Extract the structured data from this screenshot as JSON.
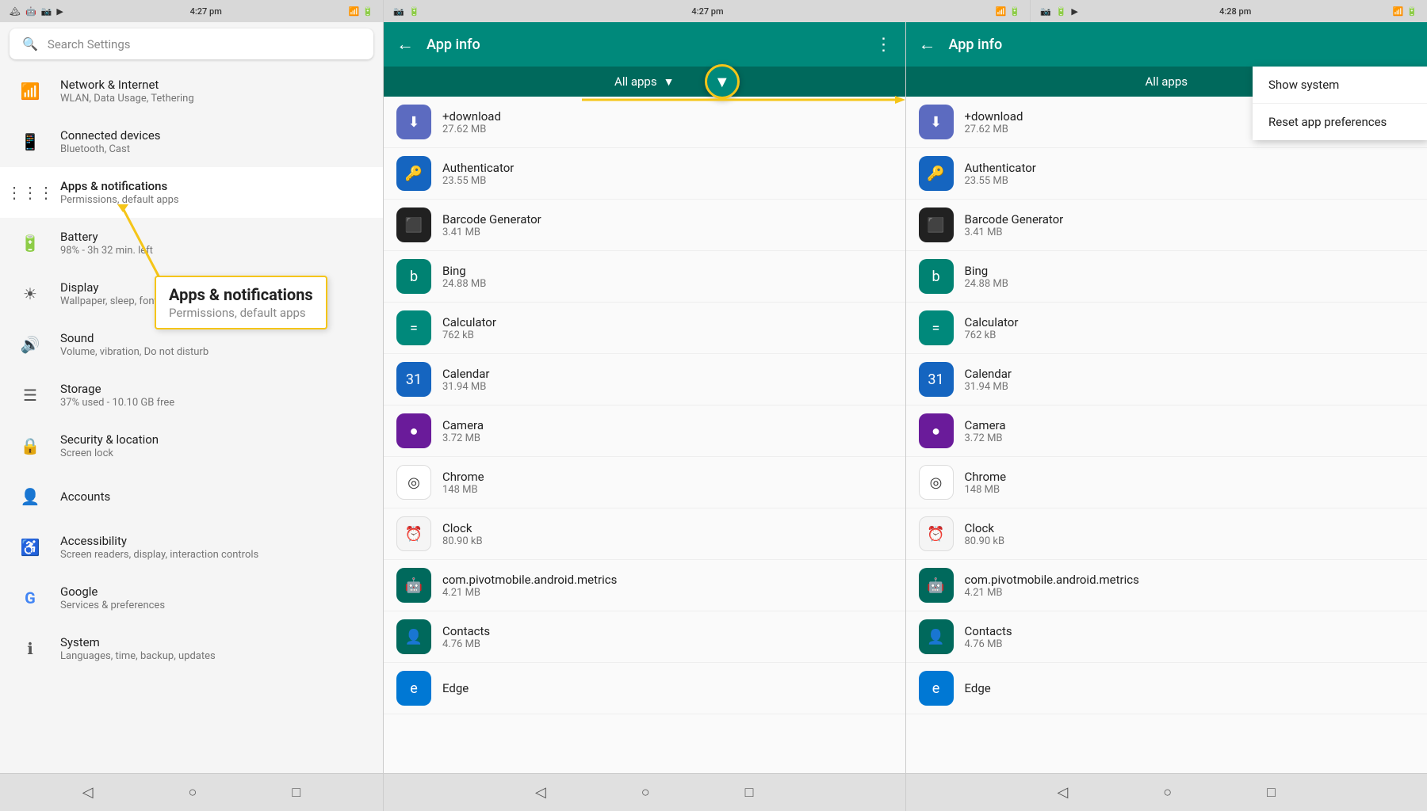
{
  "statusBar": {
    "left": {
      "time": "4:27 pm"
    },
    "middle": {
      "time": "4:27 pm"
    },
    "right": {
      "time": "4:28 pm"
    }
  },
  "settings": {
    "searchPlaceholder": "Search Settings",
    "items": [
      {
        "id": "network",
        "icon": "wifi",
        "title": "Network & Internet",
        "subtitle": "WLAN, Data Usage, Tethering"
      },
      {
        "id": "devices",
        "icon": "devices",
        "title": "Connected devices",
        "subtitle": "Bluetooth, Cast"
      },
      {
        "id": "apps",
        "icon": "apps",
        "title": "Apps & notifications",
        "subtitle": "Permissions, default apps",
        "highlighted": true
      },
      {
        "id": "battery",
        "icon": "battery",
        "title": "Battery",
        "subtitle": "98% - 3h 32 min. left"
      },
      {
        "id": "display",
        "icon": "display",
        "title": "Display",
        "subtitle": "Wallpaper, sleep, font size"
      },
      {
        "id": "sound",
        "icon": "sound",
        "title": "Sound",
        "subtitle": "Volume, vibration, Do not disturb"
      },
      {
        "id": "storage",
        "icon": "storage",
        "title": "Storage",
        "subtitle": "37% used - 10.10 GB free"
      },
      {
        "id": "security",
        "icon": "security",
        "title": "Security & location",
        "subtitle": "Screen lock"
      },
      {
        "id": "accounts",
        "icon": "accounts",
        "title": "Accounts",
        "subtitle": ""
      },
      {
        "id": "accessibility",
        "icon": "accessibility",
        "title": "Accessibility",
        "subtitle": "Screen readers, display, interaction controls"
      },
      {
        "id": "google",
        "icon": "google",
        "title": "Google",
        "subtitle": "Services & preferences"
      },
      {
        "id": "system",
        "icon": "system",
        "title": "System",
        "subtitle": "Languages, time, backup, updates"
      }
    ]
  },
  "tooltip": {
    "title": "Apps & notifications",
    "subtitle": "Permissions, default apps"
  },
  "appInfo": {
    "left": {
      "headerTitle": "App info",
      "allAppsLabel": "All apps",
      "apps": [
        {
          "name": "+download",
          "size": "27.62 MB",
          "icon": "⬇",
          "iconClass": "icon-download"
        },
        {
          "name": "Authenticator",
          "size": "23.55 MB",
          "icon": "🔑",
          "iconClass": "icon-authenticator"
        },
        {
          "name": "Barcode Generator",
          "size": "3.41 MB",
          "icon": "▦",
          "iconClass": "icon-barcode"
        },
        {
          "name": "Bing",
          "size": "24.88 MB",
          "icon": "b",
          "iconClass": "icon-bing"
        },
        {
          "name": "Calculator",
          "size": "762 kB",
          "icon": "=",
          "iconClass": "icon-calculator"
        },
        {
          "name": "Calendar",
          "size": "31.94 MB",
          "icon": "31",
          "iconClass": "icon-calendar"
        },
        {
          "name": "Camera",
          "size": "3.72 MB",
          "icon": "📷",
          "iconClass": "icon-camera"
        },
        {
          "name": "Chrome",
          "size": "148 MB",
          "icon": "🌐",
          "iconClass": "icon-chrome"
        },
        {
          "name": "Clock",
          "size": "80.90 kB",
          "icon": "🕐",
          "iconClass": "icon-clock"
        },
        {
          "name": "com.pivotmobile.android.metrics",
          "size": "4.21 MB",
          "icon": "🤖",
          "iconClass": "icon-metrics"
        },
        {
          "name": "Contacts",
          "size": "4.76 MB",
          "icon": "👤",
          "iconClass": "icon-contacts"
        },
        {
          "name": "Edge",
          "size": "",
          "icon": "e",
          "iconClass": "icon-edge"
        }
      ]
    },
    "right": {
      "headerTitle": "App info",
      "allAppsLabel": "All apps",
      "apps": [
        {
          "name": "+download",
          "size": "27.62 MB",
          "icon": "⬇",
          "iconClass": "icon-download"
        },
        {
          "name": "Authenticator",
          "size": "23.55 MB",
          "icon": "🔑",
          "iconClass": "icon-authenticator"
        },
        {
          "name": "Barcode Generator",
          "size": "3.41 MB",
          "icon": "▦",
          "iconClass": "icon-barcode"
        },
        {
          "name": "Bing",
          "size": "24.88 MB",
          "icon": "b",
          "iconClass": "icon-bing"
        },
        {
          "name": "Calculator",
          "size": "762 kB",
          "icon": "=",
          "iconClass": "icon-calculator"
        },
        {
          "name": "Calendar",
          "size": "31.94 MB",
          "icon": "31",
          "iconClass": "icon-calendar"
        },
        {
          "name": "Camera",
          "size": "3.72 MB",
          "icon": "📷",
          "iconClass": "icon-camera"
        },
        {
          "name": "Chrome",
          "size": "148 MB",
          "icon": "🌐",
          "iconClass": "icon-chrome"
        },
        {
          "name": "Clock",
          "size": "80.90 kB",
          "icon": "🕐",
          "iconClass": "icon-clock"
        },
        {
          "name": "com.pivotmobile.android.metrics",
          "size": "4.21 MB",
          "icon": "🤖",
          "iconClass": "icon-metrics"
        },
        {
          "name": "Contacts",
          "size": "4.76 MB",
          "icon": "👤",
          "iconClass": "icon-contacts"
        },
        {
          "name": "Edge",
          "size": "",
          "icon": "e",
          "iconClass": "icon-edge"
        }
      ]
    }
  },
  "contextMenu": {
    "items": [
      {
        "id": "show-system",
        "label": "Show system"
      },
      {
        "id": "reset-prefs",
        "label": "Reset app preferences"
      }
    ]
  },
  "navBar": {
    "buttons": [
      "◁",
      "○",
      "□"
    ]
  }
}
